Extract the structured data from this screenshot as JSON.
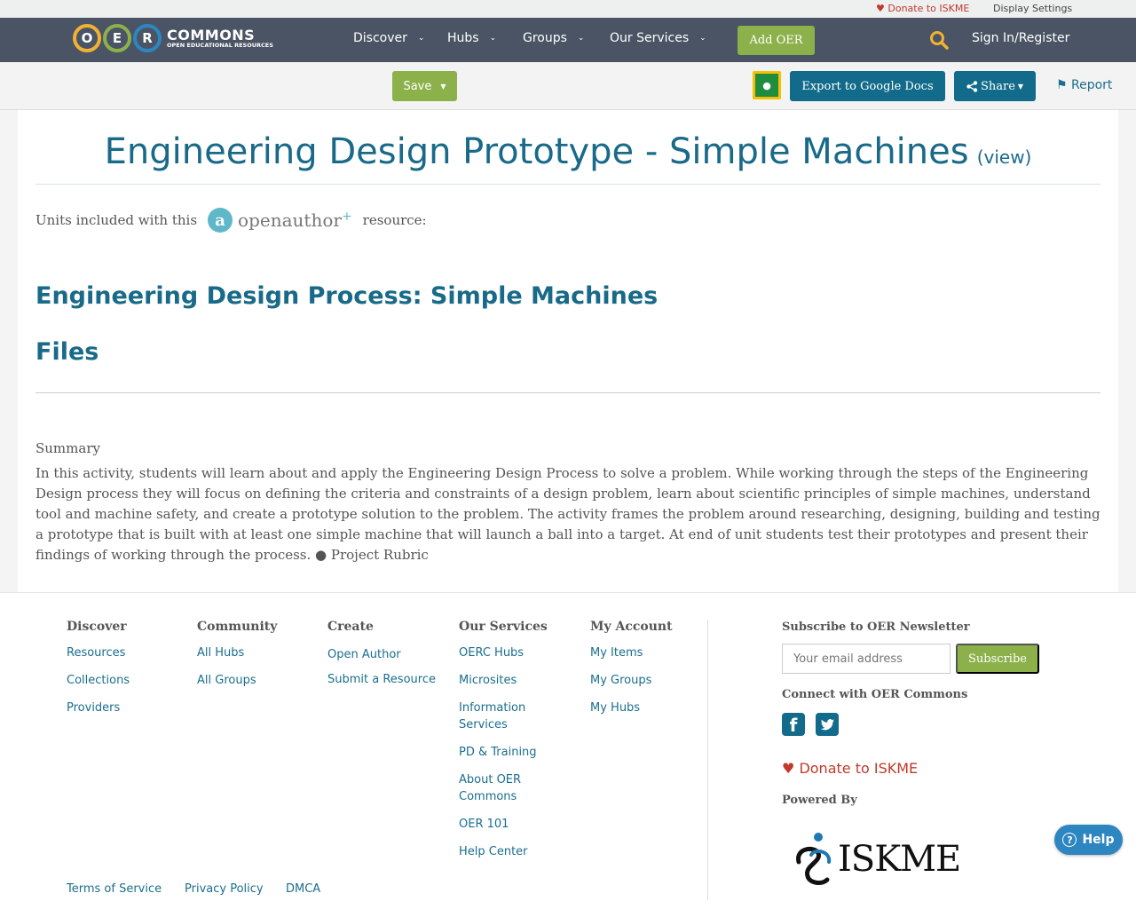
{
  "util": {
    "donate": "Donate to ISKME",
    "display_settings": "Display Settings"
  },
  "nav": {
    "logo_letters": [
      "O",
      "E",
      "R"
    ],
    "logo_word": "COMMONS",
    "logo_sub": "OPEN EDUCATIONAL RESOURCES",
    "items": [
      "Discover",
      "Hubs",
      "Groups",
      "Our Services"
    ],
    "add_oer": "Add OER",
    "sign_in": "Sign In/Register"
  },
  "toolbar": {
    "save": "Save",
    "export": "Export to Google Docs",
    "share": "Share",
    "report": "Report"
  },
  "content": {
    "title": "Engineering Design Prototype - Simple Machines",
    "view": "(view)",
    "units_prefix": "Units included with this",
    "oa_letter": "a",
    "oa_text": "openauthor",
    "oa_plus": "+",
    "units_suffix": "resource:",
    "unit_title": "Engineering Design Process: Simple Machines",
    "files": "Files",
    "summary_label": "Summary",
    "summary_text": "In this activity, students will learn about and apply the Engineering Design Process to solve a problem. While working through the steps of the Engineering Design process they will focus on defining the criteria and constraints of a design problem, learn about scientific principles of simple machines, understand tool and machine safety, and create a prototype solution to the problem. The activity frames the problem around researching, designing, building and testing a prototype that is built with at least one simple machine that will launch a ball into a target. At end of unit students test their prototypes and present their findings of working through the process. ● Project Rubric"
  },
  "footer": {
    "columns": [
      {
        "heading": "Discover",
        "links": [
          "Resources",
          "Collections",
          "Providers"
        ]
      },
      {
        "heading": "Community",
        "links": [
          "All Hubs",
          "All Groups"
        ]
      },
      {
        "heading": "Create",
        "links": [
          "Open Author",
          "Submit a Resource"
        ]
      },
      {
        "heading": "Our Services",
        "links": [
          "OERC Hubs",
          "Microsites",
          "Information Services",
          "PD & Training",
          "About OER Commons",
          "OER 101",
          "Help Center"
        ]
      },
      {
        "heading": "My Account",
        "links": [
          "My Items",
          "My Groups",
          "My Hubs"
        ]
      }
    ],
    "subscribe_heading": "Subscribe to OER Newsletter",
    "email_placeholder": "Your email address",
    "subscribe_button": "Subscribe",
    "connect_heading": "Connect with OER Commons",
    "fb_letter": "f",
    "donate": "Donate to ISKME",
    "powered_by": "Powered By",
    "iskme_word": "ISKME",
    "legal": [
      "Terms of Service",
      "Privacy Policy",
      "DMCA"
    ]
  },
  "help": {
    "glyph": "?",
    "label": "Help"
  },
  "colors": {
    "nav_bg": "#4a5465",
    "accent_green": "#8cb14b",
    "primary_teal": "#126b8a",
    "title_blue": "#196a89",
    "donate_red": "#c0392b"
  }
}
